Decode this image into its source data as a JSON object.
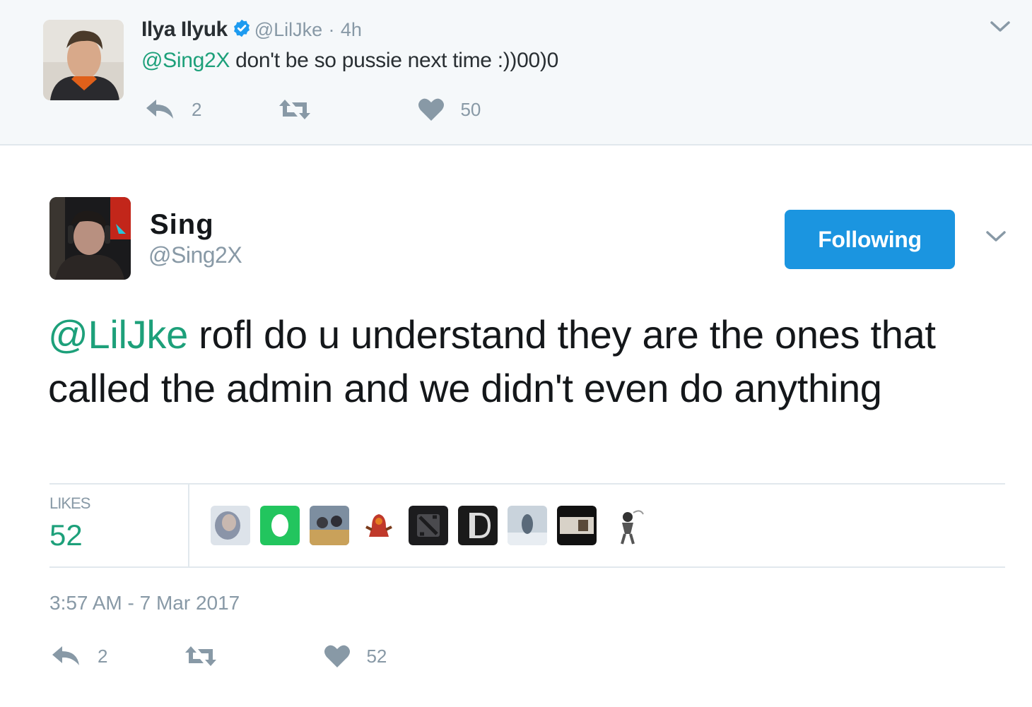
{
  "parent_tweet": {
    "name": "Ilya Ilyuk",
    "handle": "@LilJke",
    "separator": "·",
    "time": "4h",
    "mention": "@Sing2X",
    "text": " don't be so pussie next time :))00)0",
    "reply_count": "2",
    "like_count": "50"
  },
  "main_tweet": {
    "name": "Sing",
    "handle": "@Sing2X",
    "follow_button": "Following",
    "mention": "@LilJke",
    "text": " rofl do u understand they are the ones that called the admin and we didn't even do anything",
    "likes_label": "LIKES",
    "likes_count": "52",
    "timestamp": "3:57 AM - 7 Mar 2017",
    "reply_count": "2",
    "like_count": "52"
  },
  "colors": {
    "accent_green": "#1da07a",
    "follow_blue": "#1b95e0",
    "muted": "#8899a6"
  }
}
